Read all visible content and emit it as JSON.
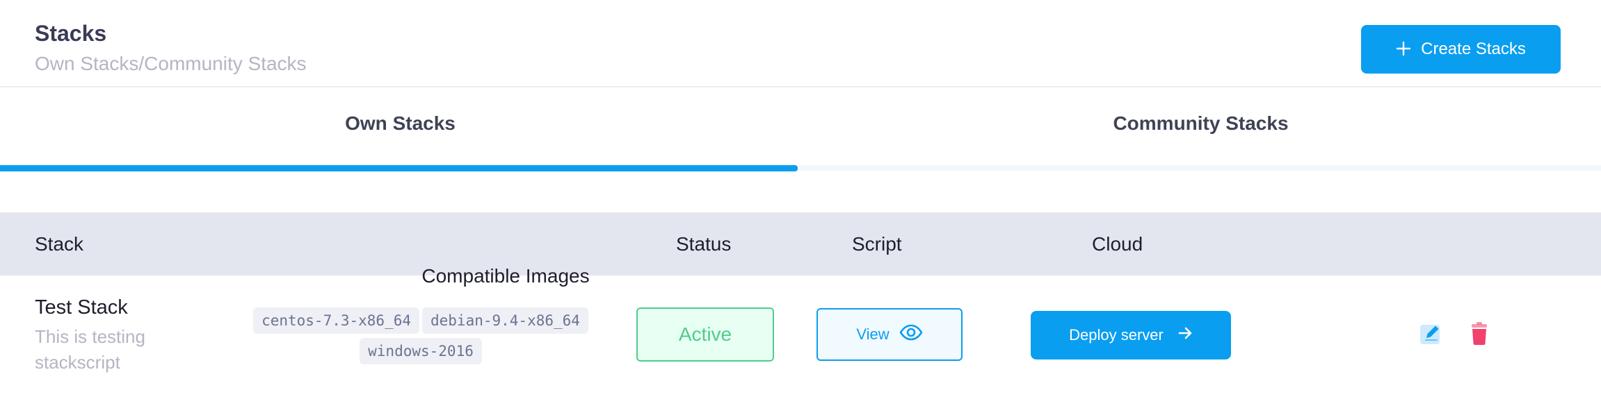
{
  "header": {
    "title": "Stacks",
    "subtitle": "Own Stacks/Community Stacks",
    "create_button": "Create Stacks",
    "create_icon": "plus-icon"
  },
  "tabs": [
    {
      "label": "Own Stacks",
      "active": true
    },
    {
      "label": "Community Stacks",
      "active": false
    }
  ],
  "table": {
    "columns": [
      "Stack",
      "Compatible Images",
      "Status",
      "Script",
      "Cloud"
    ],
    "rows": [
      {
        "name": "Test Stack",
        "description": "This is testing stackscript",
        "images": [
          "centos-7.3-x86_64",
          "debian-9.4-x86_64",
          "windows-2016"
        ],
        "status": "Active",
        "script_button": "View",
        "script_icon": "eye-icon",
        "cloud_button": "Deploy server",
        "cloud_icon": "arrow-right-icon",
        "actions": [
          "edit-icon",
          "trash-icon"
        ]
      }
    ]
  },
  "colors": {
    "primary": "#0a9ef0",
    "success": "#50cd89",
    "danger": "#f1416c",
    "header_bg": "#e4e6ef"
  }
}
